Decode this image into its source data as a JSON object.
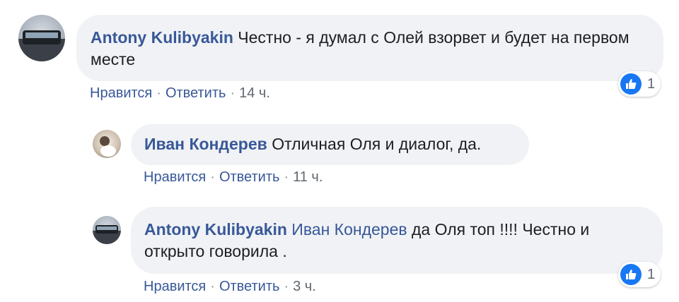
{
  "colors": {
    "link": "#385898",
    "bubble": "#f0f2f5",
    "like": "#1877f2"
  },
  "comments": [
    {
      "author": "Antony Kulibyakin",
      "text": "Честно - я думал с Олей взорвет и будет на первом месте",
      "actions": {
        "like": "Нравится",
        "reply": "Ответить",
        "time": "14 ч."
      },
      "reaction": {
        "icon": "thumbs-up-icon",
        "count": "1"
      }
    },
    {
      "author": "Иван Кондерев",
      "text": "Отличная Оля и диалог, да.",
      "actions": {
        "like": "Нравится",
        "reply": "Ответить",
        "time": "11 ч."
      }
    },
    {
      "author": "Antony Kulibyakin",
      "mention": "Иван Кондерев",
      "text": "да Оля топ !!!! Честно и открыто говорила .",
      "actions": {
        "like": "Нравится",
        "reply": "Ответить",
        "time": "3 ч."
      },
      "reaction": {
        "icon": "thumbs-up-icon",
        "count": "1"
      }
    }
  ]
}
